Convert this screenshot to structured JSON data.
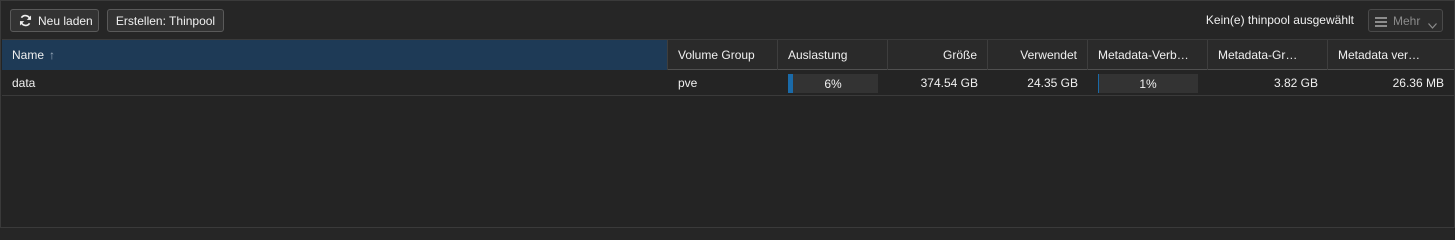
{
  "toolbar": {
    "reload_label": "Neu laden",
    "reload_icon": "refresh-icon",
    "create_label": "Erstellen: Thinpool",
    "status_text": "Kein(e) thinpool ausgewählt",
    "more_label": "Mehr",
    "more_icon": "menu-icon"
  },
  "columns": {
    "name": "Name",
    "volume_group": "Volume Group",
    "usage": "Auslastung",
    "size": "Größe",
    "used": "Verwendet",
    "meta_used": "Metadata-Verb…",
    "meta_size": "Metadata-Gr…",
    "meta_used_abs": "Metadata ver…"
  },
  "sort": {
    "column": "name",
    "direction": "ascending",
    "indicator": "↑"
  },
  "rows": [
    {
      "name": "data",
      "volume_group": "pve",
      "usage_label": "6%",
      "usage_fraction": 0.06,
      "size": "374.54 GB",
      "used": "24.35 GB",
      "meta_usage_label": "1%",
      "meta_usage_fraction": 0.01,
      "meta_size": "3.82 GB",
      "meta_used": "26.36 MB"
    }
  ],
  "colors": {
    "background": "#242424",
    "sorted_header": "#1e3a56",
    "progress_fill": "#1a6aa8"
  }
}
